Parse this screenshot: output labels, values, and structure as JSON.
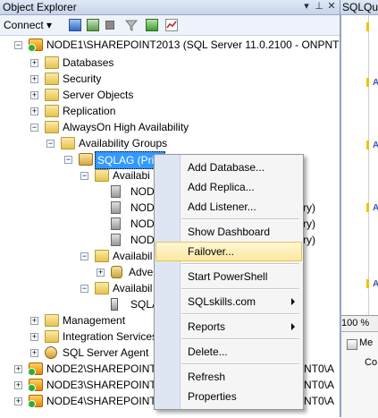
{
  "object_explorer": {
    "title": "Object Explorer",
    "toolbar": {
      "connect_label": "Connect"
    },
    "tree": [
      {
        "label": "NODE1\\SHAREPOINT2013 (SQL Server 11.0.2100 - ONPNT0\\A",
        "expander": "−"
      },
      {
        "label": "Databases",
        "expander": "+"
      },
      {
        "label": "Security",
        "expander": "+"
      },
      {
        "label": "Server Objects",
        "expander": "+"
      },
      {
        "label": "Replication",
        "expander": "+"
      },
      {
        "label": "AlwaysOn High Availability",
        "expander": "−"
      },
      {
        "label": "Availability Groups",
        "expander": "−"
      },
      {
        "label": "SQLAG (Prim",
        "expander": "−"
      },
      {
        "label": "Availabi",
        "expander": "−"
      },
      {
        "label": "NOD",
        "expander": ""
      },
      {
        "label": "NOD",
        "suffix": "ry)",
        "expander": ""
      },
      {
        "label": "NOD",
        "suffix": "ry)",
        "expander": ""
      },
      {
        "label": "NOD",
        "suffix": "ry)",
        "expander": ""
      },
      {
        "label": "Availabil",
        "expander": "−"
      },
      {
        "label": "Adve",
        "expander": "+"
      },
      {
        "label": "Availabil",
        "expander": "−"
      },
      {
        "label": "SQLA",
        "expander": ""
      },
      {
        "label": "Management",
        "expander": "+"
      },
      {
        "label": "Integration Services",
        "expander": "+"
      },
      {
        "label": "SQL Server Agent",
        "expander": "+"
      },
      {
        "label": "NODE2\\SHAREPOINT20",
        "suffix": "NT0\\A",
        "expander": "+"
      },
      {
        "label": "NODE3\\SHAREPOINT20",
        "suffix": "NT0\\A",
        "expander": "+"
      },
      {
        "label": "NODE4\\SHAREPOINT20",
        "suffix": "NT0\\A",
        "expander": "+"
      }
    ]
  },
  "right_panel": {
    "tab_title": "SQLQu",
    "zoom": "100 %",
    "results_tab": "Me",
    "results_text": "Co"
  },
  "context_menu": {
    "items": [
      {
        "label": "Add Database..."
      },
      {
        "label": "Add Replica..."
      },
      {
        "label": "Add Listener..."
      },
      {
        "label": "Show Dashboard"
      },
      {
        "label": "Failover...",
        "highlighted": true
      },
      {
        "label": "Start PowerShell"
      },
      {
        "label": "SQLskills.com",
        "submenu": true
      },
      {
        "label": "Reports",
        "submenu": true
      },
      {
        "label": "Delete..."
      },
      {
        "label": "Refresh"
      },
      {
        "label": "Properties"
      }
    ]
  },
  "colors": {
    "selection": "#3399ff",
    "menu_highlight": "#fce8a0",
    "title_bar": "#c7d4e8"
  }
}
